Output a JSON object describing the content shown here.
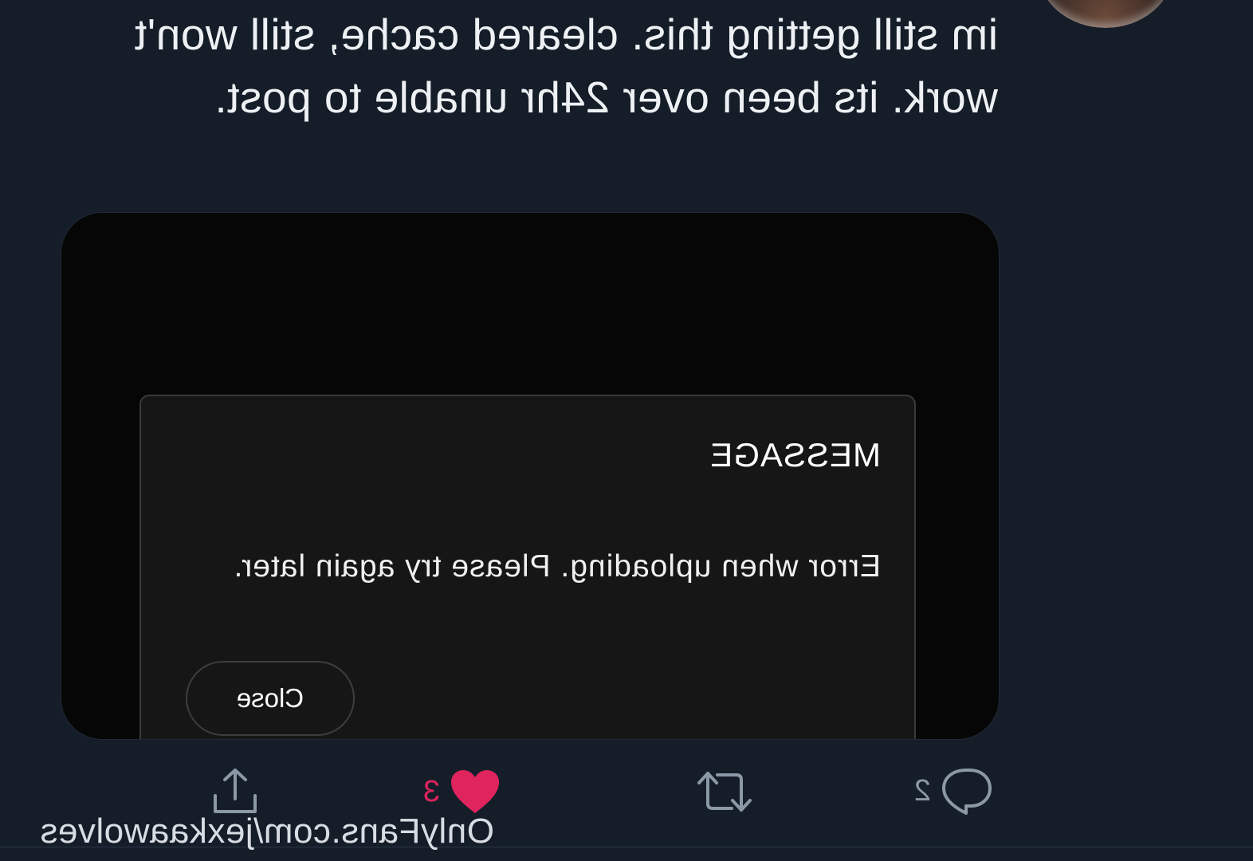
{
  "tweet": {
    "text": "im still getting this. cleared cache, still won't work. its been over 24hr unable to post."
  },
  "screenshot": {
    "dialog_title": "MESSAGE",
    "dialog_body": "Error when uploading. Please try again later.",
    "close_label": "Close"
  },
  "actions": {
    "replies": "2",
    "likes": "3"
  },
  "watermark": "OnlyFans.com/jexkaawolves",
  "colors": {
    "background": "#151d29",
    "like": "#e0245e",
    "icon": "#8b98a5"
  },
  "display": {
    "mirrored": true
  }
}
